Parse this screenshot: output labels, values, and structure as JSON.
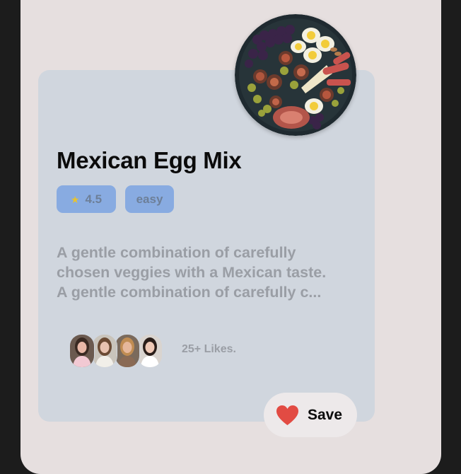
{
  "recipe": {
    "title": "Mexican Egg Mix",
    "rating": "4.5",
    "difficulty": "easy",
    "description_lines": [
      "A gentle combination of carefully",
      "chosen veggies with a Mexican taste.",
      "A gentle combination of carefully c..."
    ],
    "likes": "25+ Likes.",
    "save_label": "Save",
    "avatars": [
      {
        "name": "avatar-1",
        "bg": "#6b5a4f",
        "face": "#e9b9a8",
        "hair": "#3a2a22",
        "shirt": "#f2c9d3"
      },
      {
        "name": "avatar-2",
        "bg": "#c9c4bb",
        "face": "#e8c3b0",
        "hair": "#6a4a33",
        "shirt": "#f1efe9"
      },
      {
        "name": "avatar-3",
        "bg": "#7a6a5c",
        "face": "#e6b79a",
        "hair": "#c08c52",
        "shirt": "#8a6a54"
      },
      {
        "name": "avatar-4",
        "bg": "#d9d4cf",
        "face": "#efc9b6",
        "hair": "#2a1e19",
        "shirt": "#ffffff"
      }
    ]
  },
  "colors": {
    "card_bg": "#d0d6de",
    "chip_bg": "#88abe1",
    "heart": "#e24b43",
    "star": "#e7c331"
  },
  "icons": [
    "food-plate-image",
    "star-icon",
    "heart-icon"
  ]
}
